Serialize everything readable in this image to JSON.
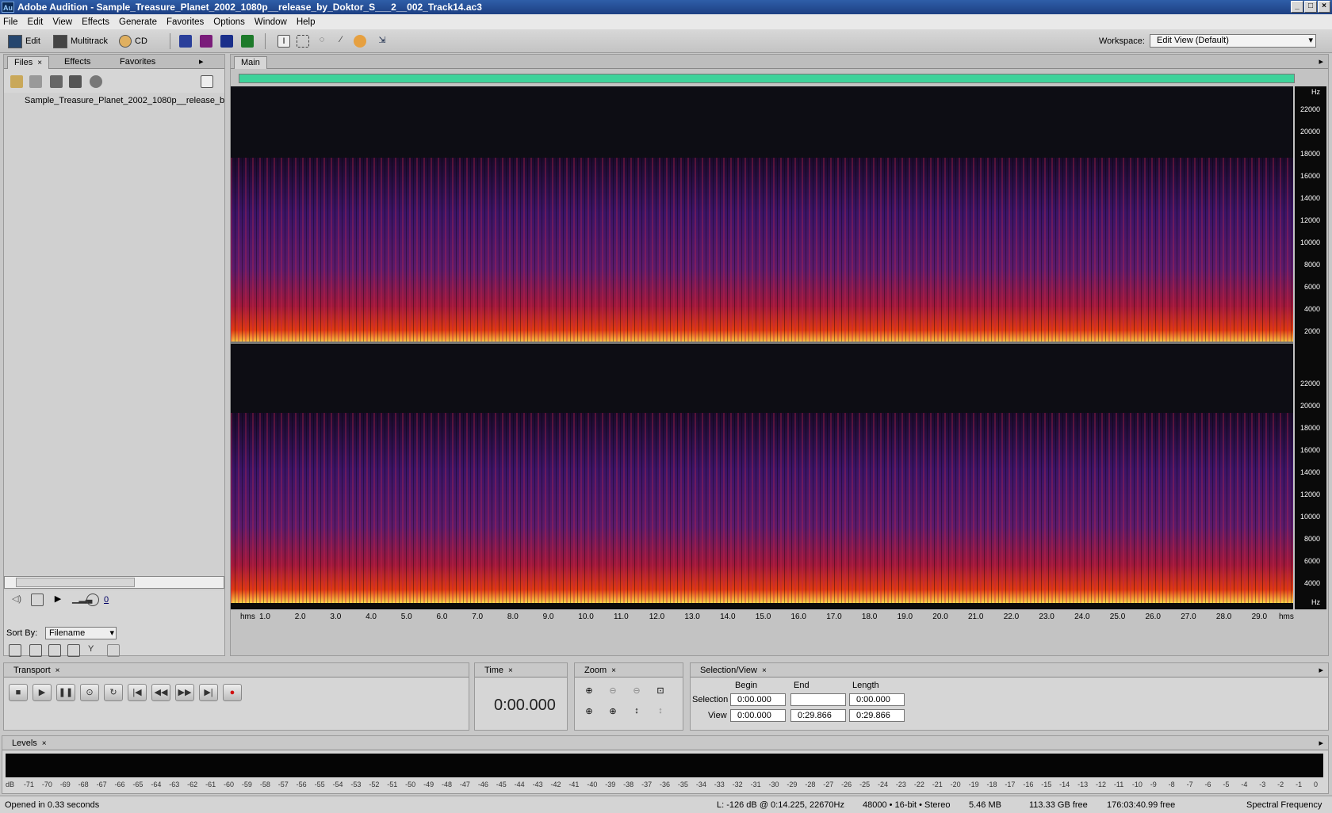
{
  "window": {
    "title": "Adobe Audition - Sample_Treasure_Planet_2002_1080p__release_by_Doktor_S___2__002_Track14.ac3",
    "app_icon": "Au"
  },
  "menu": [
    "File",
    "Edit",
    "View",
    "Effects",
    "Generate",
    "Favorites",
    "Options",
    "Window",
    "Help"
  ],
  "toolbar": {
    "edit_label": "Edit",
    "multitrack_label": "Multitrack",
    "cd_label": "CD",
    "workspace_label": "Workspace:",
    "workspace_value": "Edit View (Default)"
  },
  "files_panel": {
    "tabs": [
      "Files",
      "Effects",
      "Favorites"
    ],
    "file_name": "Sample_Treasure_Planet_2002_1080p__release_b",
    "sort_label": "Sort By:",
    "sort_value": "Filename",
    "volume_value": "0"
  },
  "main": {
    "tab": "Main",
    "time_unit": "hms",
    "freq_unit": "Hz",
    "time_ticks": [
      "1.0",
      "2.0",
      "3.0",
      "4.0",
      "5.0",
      "6.0",
      "7.0",
      "8.0",
      "9.0",
      "10.0",
      "11.0",
      "12.0",
      "13.0",
      "14.0",
      "15.0",
      "16.0",
      "17.0",
      "18.0",
      "19.0",
      "20.0",
      "21.0",
      "22.0",
      "23.0",
      "24.0",
      "25.0",
      "26.0",
      "27.0",
      "28.0",
      "29.0"
    ],
    "freq_ticks": [
      "22000",
      "20000",
      "18000",
      "16000",
      "14000",
      "12000",
      "10000",
      "8000",
      "6000",
      "4000",
      "2000"
    ]
  },
  "transport": {
    "title": "Transport"
  },
  "time_panel": {
    "title": "Time",
    "value": "0:00.000"
  },
  "zoom_panel": {
    "title": "Zoom"
  },
  "selview": {
    "title": "Selection/View",
    "begin_hdr": "Begin",
    "end_hdr": "End",
    "length_hdr": "Length",
    "selection_label": "Selection",
    "view_label": "View",
    "sel_begin": "0:00.000",
    "sel_end": "",
    "sel_length": "0:00.000",
    "view_begin": "0:00.000",
    "view_end": "0:29.866",
    "view_length": "0:29.866"
  },
  "levels": {
    "title": "Levels",
    "scale": [
      "dB",
      "-71",
      "-70",
      "-69",
      "-68",
      "-67",
      "-66",
      "-65",
      "-64",
      "-63",
      "-62",
      "-61",
      "-60",
      "-59",
      "-58",
      "-57",
      "-56",
      "-55",
      "-54",
      "-53",
      "-52",
      "-51",
      "-50",
      "-49",
      "-48",
      "-47",
      "-46",
      "-45",
      "-44",
      "-43",
      "-42",
      "-41",
      "-40",
      "-39",
      "-38",
      "-37",
      "-36",
      "-35",
      "-34",
      "-33",
      "-32",
      "-31",
      "-30",
      "-29",
      "-28",
      "-27",
      "-26",
      "-25",
      "-24",
      "-23",
      "-22",
      "-21",
      "-20",
      "-19",
      "-18",
      "-17",
      "-16",
      "-15",
      "-14",
      "-13",
      "-12",
      "-11",
      "-10",
      "-9",
      "-8",
      "-7",
      "-6",
      "-5",
      "-4",
      "-3",
      "-2",
      "-1",
      "0"
    ]
  },
  "status": {
    "opened": "Opened in 0.33 seconds",
    "cursor": "L: -126 dB @  0:14.225, 22670Hz",
    "format": "48000 • 16-bit • Stereo",
    "size": "5.46 MB",
    "free": "113.33 GB free",
    "time_free": "176:03:40.99 free",
    "view_mode": "Spectral Frequency"
  }
}
